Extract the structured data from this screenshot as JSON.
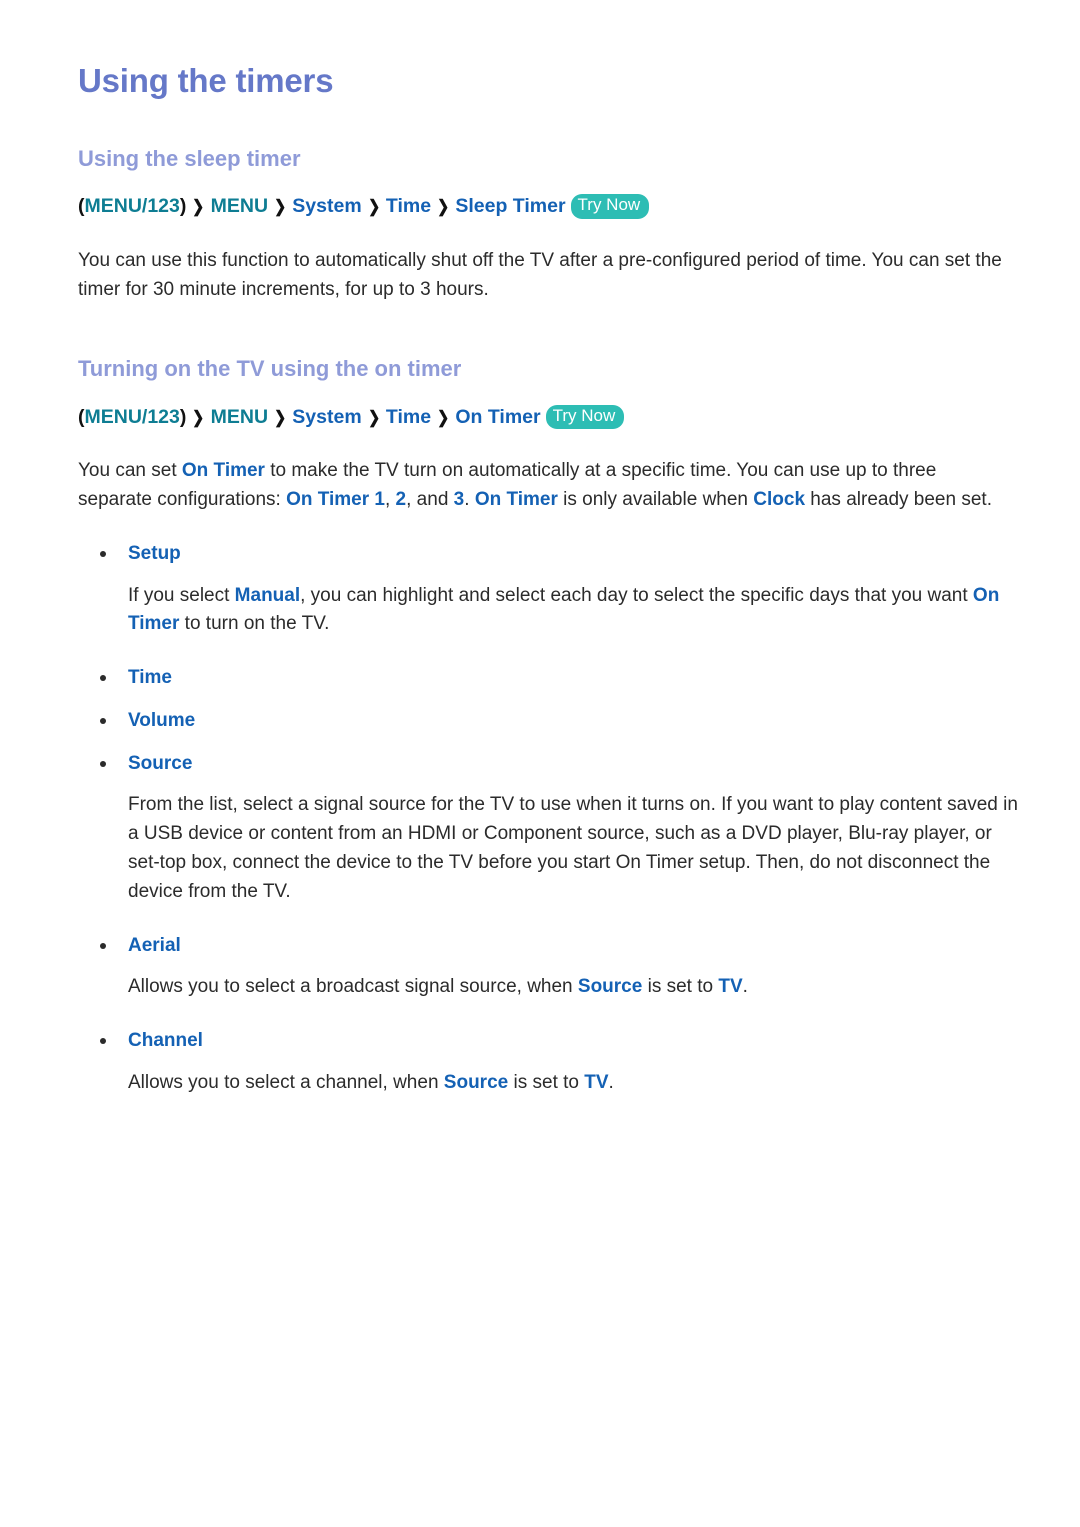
{
  "document": {
    "title": "Using the timers"
  },
  "sections": [
    {
      "heading": "Using the sleep timer",
      "breadcrumb": {
        "open_paren": "(",
        "menu123": "MENU/123",
        "close_paren": ")",
        "separator": "❯",
        "items": [
          "MENU",
          "System",
          "Time",
          "Sleep Timer"
        ],
        "badge": "Try Now"
      },
      "paragraph": {
        "part1": "You can use this function to automatically shut off the TV after a pre-configured period of time. You can set the timer for 30 minute increments, for up to 3 hours."
      }
    },
    {
      "heading": "Turning on the TV using the on timer",
      "breadcrumb": {
        "open_paren": "(",
        "menu123": "MENU/123",
        "close_paren": ")",
        "separator": "❯",
        "items": [
          "MENU",
          "System",
          "Time",
          "On Timer"
        ],
        "badge": "Try Now"
      },
      "intro": {
        "t1": "You can set ",
        "k1": "On Timer",
        "t2": " to make the TV turn on automatically at a specific time. You can use up to three separate configurations: ",
        "k2": "On Timer 1",
        "t3": ", ",
        "k3": "2",
        "t4": ", and ",
        "k4": "3",
        "t5": ". ",
        "k5": "On Timer",
        "t6": " is only available when ",
        "k6": "Clock",
        "t7": " has already been set."
      }
    }
  ],
  "options": [
    {
      "label": "Setup",
      "description": {
        "t1": "If you select ",
        "k1": "Manual",
        "t2": ", you can highlight and select each day to select the specific days that you want ",
        "k2": "On Timer",
        "t3": " to turn on the TV."
      }
    },
    {
      "label": "Time",
      "description": null
    },
    {
      "label": "Volume",
      "description": null
    },
    {
      "label": "Source",
      "description": {
        "t1": "From the list, select a signal source for the TV to use when it turns on. If you want to play content saved in a USB device or content from an HDMI or Component source, such as a DVD player, Blu-ray player, or set-top box, connect the device to the TV before you start On Timer setup. Then, do not disconnect the device from the TV."
      }
    },
    {
      "label": "Aerial",
      "description": {
        "t1": "Allows you to select a broadcast signal source, when ",
        "k1": "Source",
        "t2": " is set to ",
        "k2": "TV",
        "t3": "."
      }
    },
    {
      "label": "Channel",
      "description": {
        "t1": "Allows you to select a channel, when ",
        "k1": "Source",
        "t2": " is set to ",
        "k2": "TV",
        "t3": "."
      }
    }
  ],
  "colors": {
    "title": "#6578c8",
    "section_heading": "#8f9bd8",
    "keyword_blue": "#1461b4",
    "menu_teal": "#0e7d93",
    "badge_bg": "#2dbdb4",
    "body_text": "#2b2b2b"
  }
}
